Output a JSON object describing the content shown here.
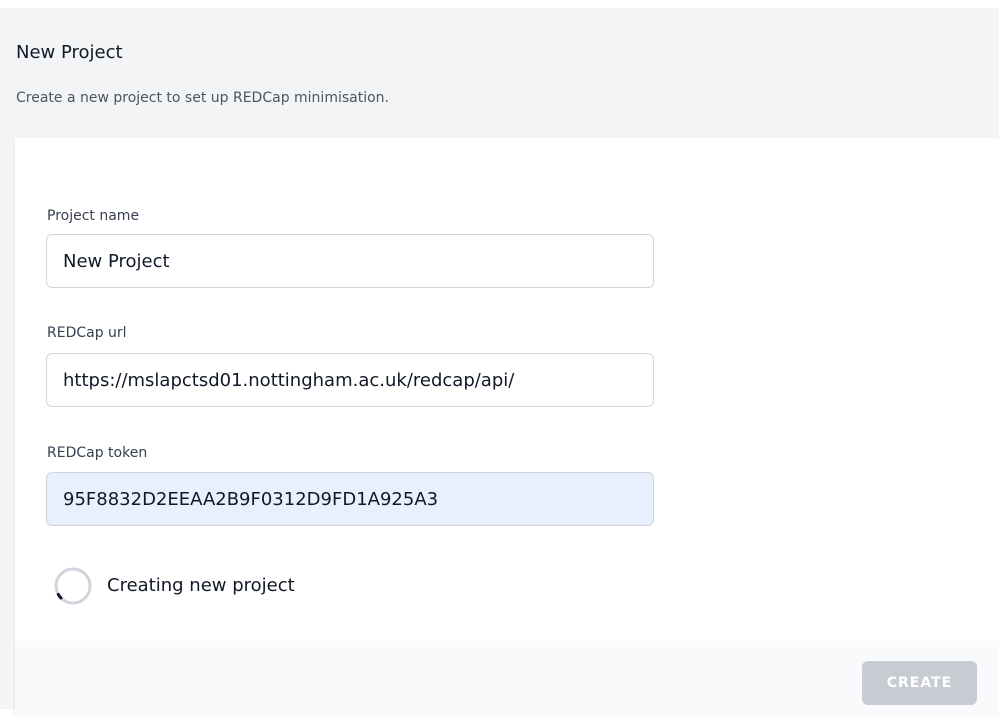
{
  "header": {
    "title": "New Project",
    "subtitle": "Create a new project to set up REDCap minimisation."
  },
  "form": {
    "project_name": {
      "label": "Project name",
      "value": "New Project"
    },
    "redcap_url": {
      "label": "REDCap url",
      "value": "https://mslapctsd01.nottingham.ac.uk/redcap/api/"
    },
    "redcap_token": {
      "label": "REDCap token",
      "value": "95F8832D2EEAA2B9F0312D9FD1A925A3"
    }
  },
  "status": {
    "icon": "loading-spinner-icon",
    "text": "Creating new project"
  },
  "footer": {
    "create_label": "CREATE"
  },
  "colors": {
    "page_background": "#f3f4f6",
    "card_background": "#ffffff",
    "autofill_background": "#e8f0fe",
    "button_disabled": "#c8ccd2",
    "spinner_track": "#d1d5db",
    "spinner_arc": "#111827"
  }
}
